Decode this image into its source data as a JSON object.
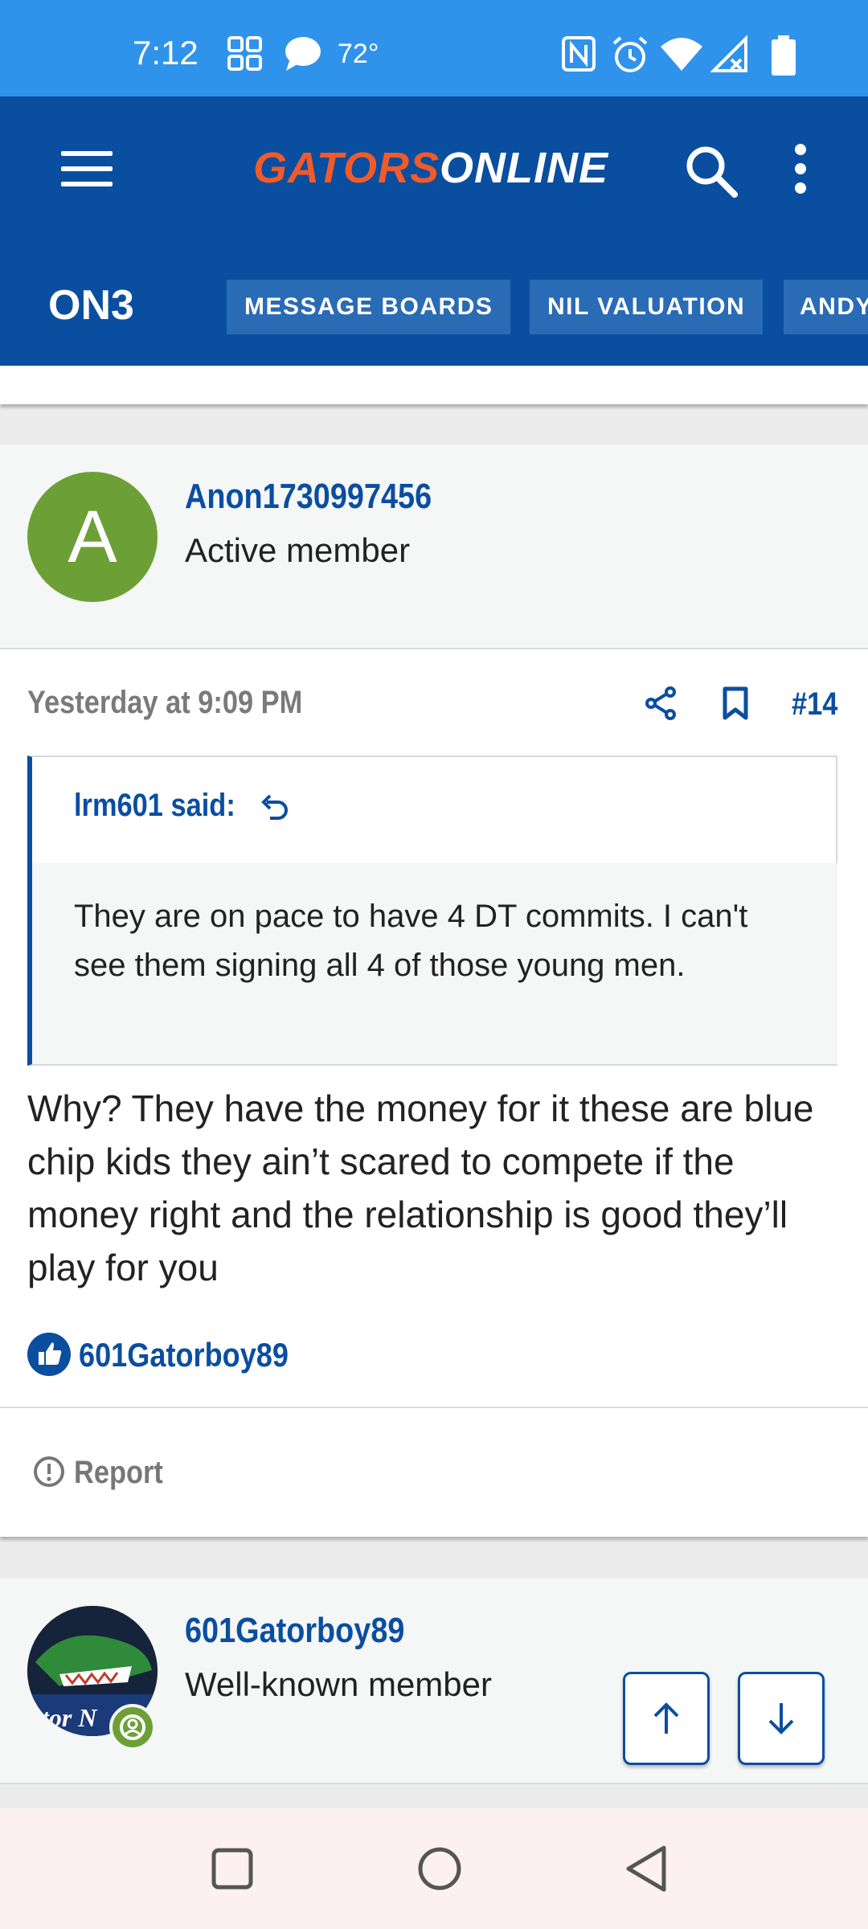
{
  "status_bar": {
    "time": "7:12",
    "temperature": "72°"
  },
  "header": {
    "logo_part1": "GATORS",
    "logo_part2": "ONLINE",
    "network_logo": "ON3",
    "nav_links": [
      "MESSAGE BOARDS",
      "NIL VALUATION",
      "ANDY"
    ]
  },
  "post": {
    "author": {
      "avatar_letter": "A",
      "name": "Anon1730997456",
      "role": "Active member"
    },
    "timestamp": "Yesterday at 9:09 PM",
    "post_number": "#14",
    "quote": {
      "author_line": "lrm601 said:",
      "text": "They are on pace to have 4 DT commits. I can't see them signing all 4 of those young men."
    },
    "body": "Why? They have the money for it these are blue chip kids they ain’t scared to compete if the money right and the relationship is good they’ll play for you",
    "likes": {
      "users": "601Gatorboy89"
    },
    "report_label": "Report"
  },
  "next_post": {
    "author": {
      "name": "601Gatorboy89",
      "role": "Well-known member",
      "avatar_text": "ator N"
    }
  },
  "icons": [
    "menu-icon",
    "search-icon",
    "more-vert-icon",
    "share-icon",
    "bookmark-icon",
    "reply-arrow-icon",
    "thumbs-up-icon",
    "report-icon",
    "arrow-up-icon",
    "arrow-down-icon",
    "nav-recents-icon",
    "nav-home-icon",
    "nav-back-icon"
  ],
  "colors": {
    "brand_blue": "#0a4ea0",
    "status_bar": "#2f93ec",
    "accent_orange": "#f15a29",
    "avatar_green": "#6ca036"
  }
}
